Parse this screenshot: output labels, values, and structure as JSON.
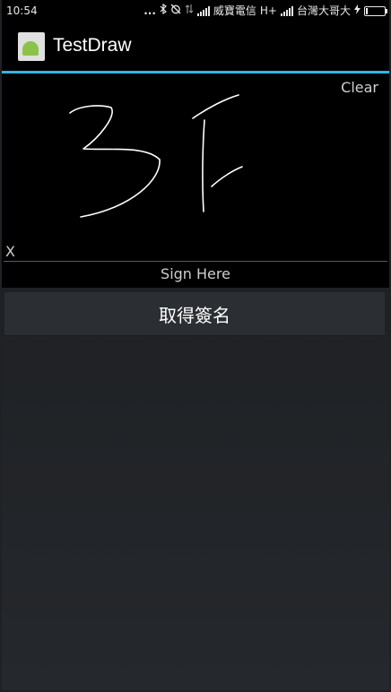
{
  "status_bar": {
    "time": "10:54",
    "dots": "...",
    "carrier1": "威寶電信",
    "network_type": "H+",
    "carrier2": "台灣大哥大"
  },
  "action_bar": {
    "title": "TestDraw",
    "icon": "android-app-icon"
  },
  "signature_pad": {
    "clear_label": "Clear",
    "x_mark": "X",
    "sign_here": "Sign Here"
  },
  "get_signature_button": {
    "label": "取得簽名"
  },
  "colors": {
    "accent": "#33b5e5",
    "pad_background": "#000000",
    "button_background": "#2b2f33"
  }
}
